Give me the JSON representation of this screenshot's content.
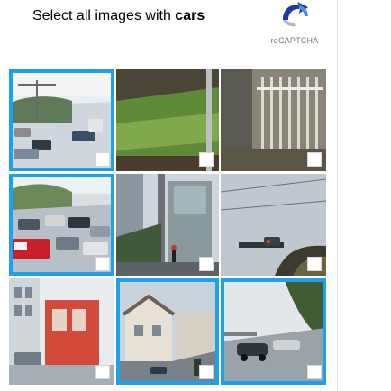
{
  "header": {
    "prompt_prefix": "Select all images with ",
    "prompt_target": "cars"
  },
  "brand": {
    "wordmark": "reCAPTCHA",
    "logo_icon": "recaptcha-logo-icon"
  },
  "grid": {
    "rows": 3,
    "cols": 3,
    "tiles": [
      {
        "id": "r1c1",
        "selected": true,
        "icon": "traffic-road-image",
        "checkbox_icon": "checkbox-icon"
      },
      {
        "id": "r1c2",
        "selected": false,
        "icon": "grass-image",
        "checkbox_icon": "checkbox-icon"
      },
      {
        "id": "r1c3",
        "selected": false,
        "icon": "fence-gate-image",
        "checkbox_icon": "checkbox-icon"
      },
      {
        "id": "r2c1",
        "selected": true,
        "icon": "traffic-queue-image",
        "checkbox_icon": "checkbox-icon"
      },
      {
        "id": "r2c2",
        "selected": false,
        "icon": "street-pole-image",
        "checkbox_icon": "checkbox-icon"
      },
      {
        "id": "r2c3",
        "selected": false,
        "icon": "traffic-light-sky-image",
        "checkbox_icon": "checkbox-icon"
      },
      {
        "id": "r3c1",
        "selected": false,
        "icon": "red-building-image",
        "checkbox_icon": "checkbox-icon"
      },
      {
        "id": "r3c2",
        "selected": true,
        "icon": "houses-street-image",
        "checkbox_icon": "checkbox-icon"
      },
      {
        "id": "r3c3",
        "selected": true,
        "icon": "road-cars-image",
        "checkbox_icon": "checkbox-icon"
      }
    ]
  },
  "colors": {
    "selection_border": "#1ea1ea"
  }
}
